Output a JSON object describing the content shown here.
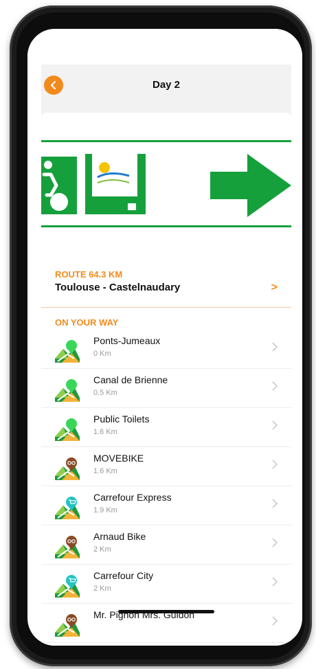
{
  "header": {
    "title": "Day 2"
  },
  "route": {
    "label": "ROUTE 64.3 KM",
    "name": "Toulouse - Castelnaudary",
    "chevron": ">"
  },
  "section": {
    "title": "ON YOUR WAY"
  },
  "places": [
    {
      "name": "Ponts-Jumeaux",
      "distance": "0 Km",
      "icon": "green-pin-icon"
    },
    {
      "name": "Canal de Brienne",
      "distance": "0.5 Km",
      "icon": "green-pin-icon"
    },
    {
      "name": "Public Toilets",
      "distance": "1.6 Km",
      "icon": "green-pin-icon"
    },
    {
      "name": "MOVEBIKE",
      "distance": "1.6 Km",
      "icon": "bike-pin-icon"
    },
    {
      "name": "Carrefour Express",
      "distance": "1.9 Km",
      "icon": "cart-pin-icon"
    },
    {
      "name": "Arnaud Bike",
      "distance": "2 Km",
      "icon": "bike-pin-icon"
    },
    {
      "name": "Carrefour City",
      "distance": "2 Km",
      "icon": "cart-pin-icon"
    },
    {
      "name": "Mr. Pignon Mrs. Guidon",
      "distance": "",
      "icon": "bike-pin-icon"
    }
  ],
  "colors": {
    "accent": "#f28b1e",
    "green": "#16a03c",
    "brown": "#8a4a24",
    "teal": "#22c3c3"
  }
}
